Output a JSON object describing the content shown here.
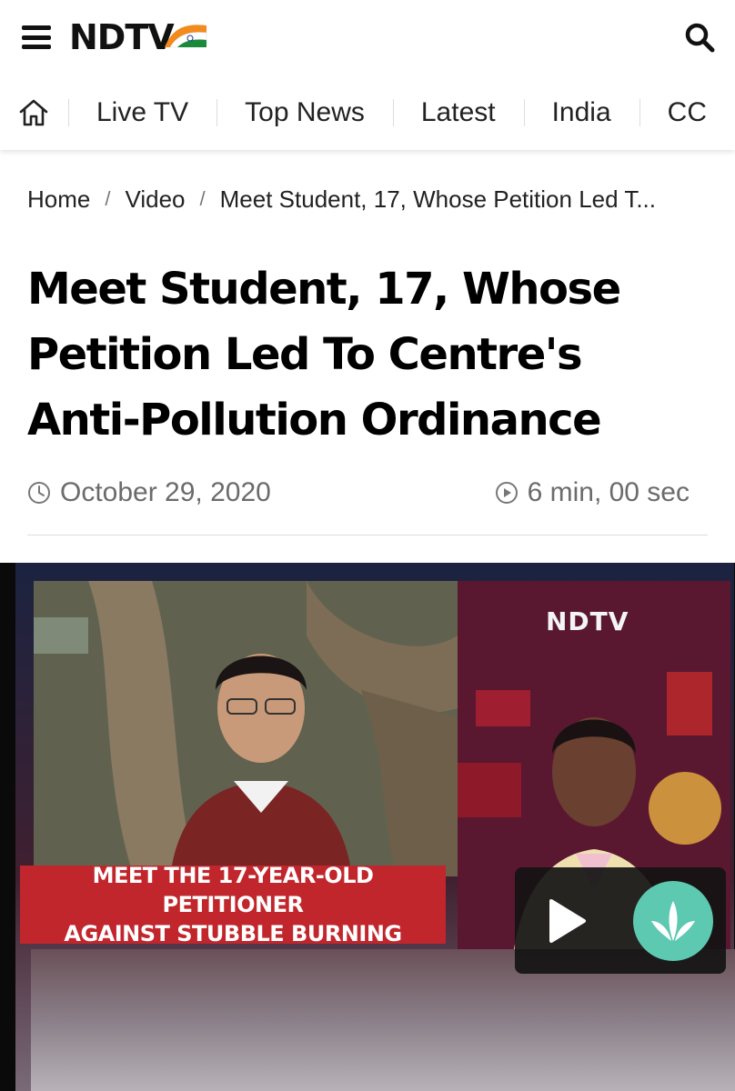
{
  "header": {
    "logo_text": "NDTV",
    "menu_icon": "hamburger-menu-icon",
    "search_icon": "search-icon",
    "colors": {
      "saffron": "#f28a1c",
      "green": "#1a8a3a",
      "red": "#d9232a"
    }
  },
  "nav": {
    "home_icon": "home-icon",
    "items": [
      "Live TV",
      "Top News",
      "Latest",
      "India",
      "CC"
    ]
  },
  "breadcrumb": {
    "items": [
      "Home",
      "Video"
    ],
    "current": "Meet Student, 17, Whose Petition Led T..."
  },
  "article": {
    "headline": "Meet Student, 17, Whose Petition Led To Centre's Anti-Pollution Ordinance",
    "date": "October 29, 2020",
    "duration": "6 min, 00 sec"
  },
  "video": {
    "watermark": "NDTV",
    "caption_line1": "MEET THE 17-YEAR-OLD PETITIONER",
    "caption_line2": "AGAINST STUBBLE BURNING",
    "play_icon": "play-icon",
    "saavn_icon": "jiosaavn-logo-icon",
    "caption_color": "#c0262c"
  }
}
